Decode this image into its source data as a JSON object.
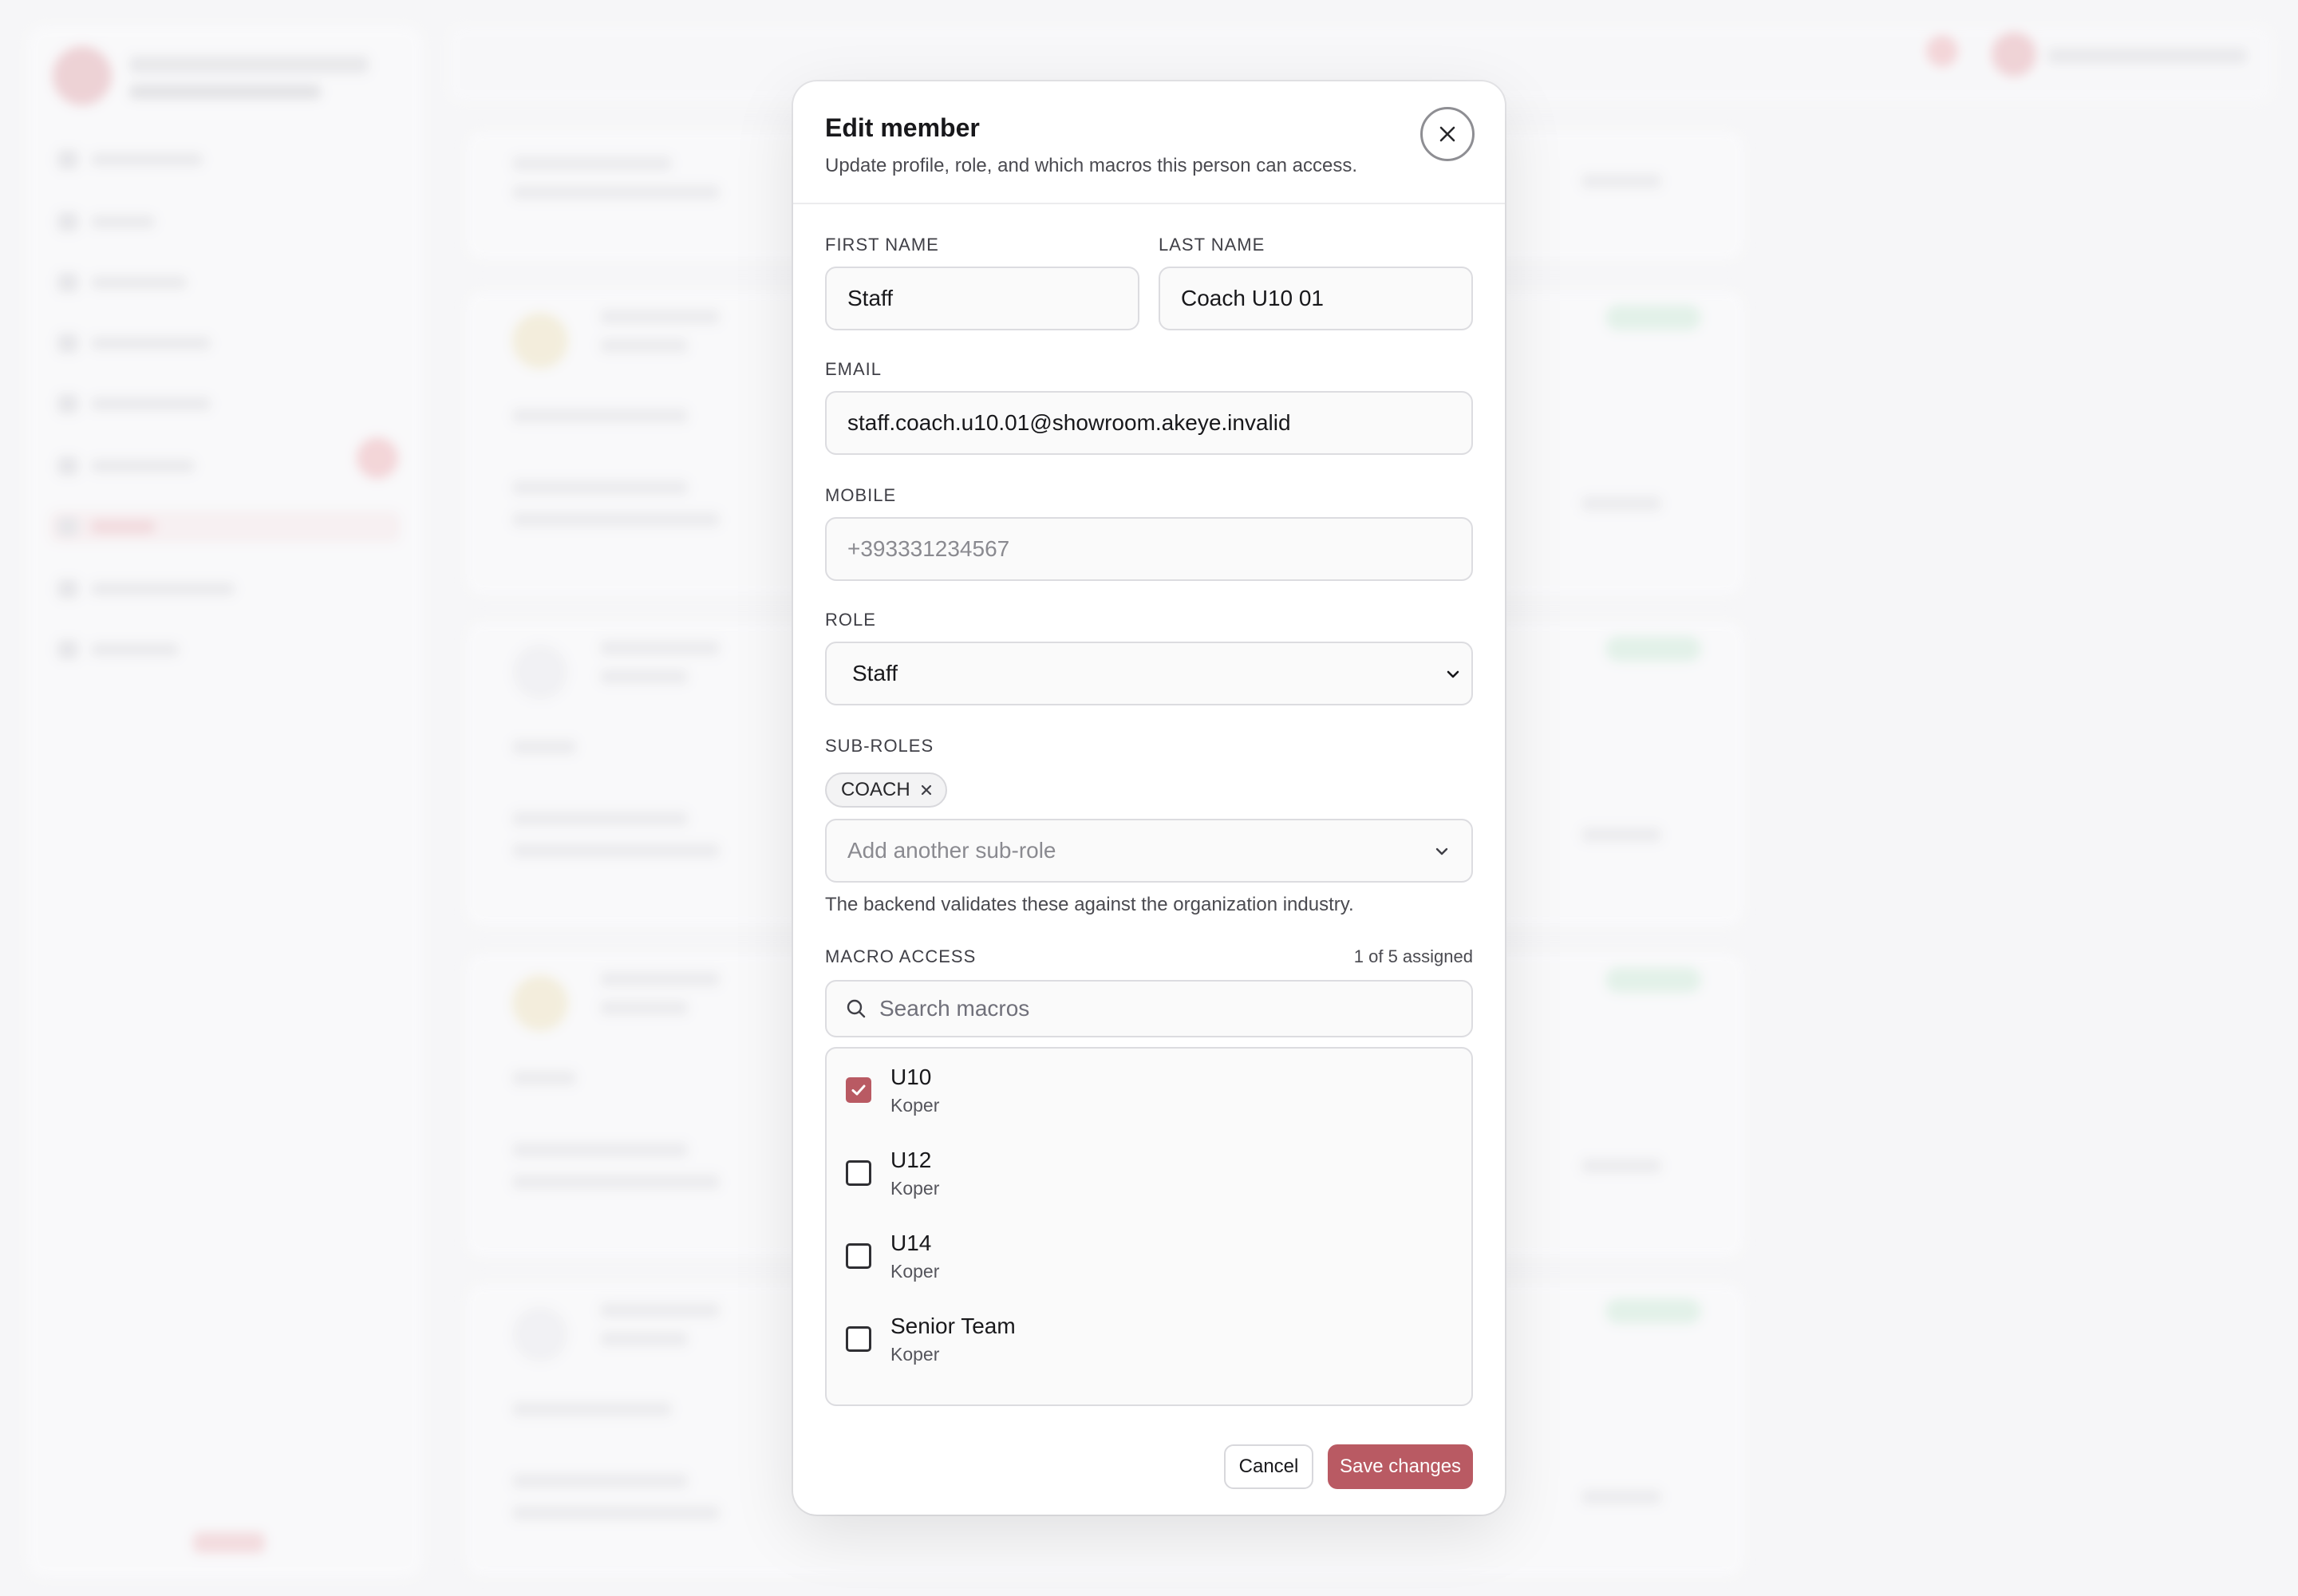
{
  "modal": {
    "title": "Edit member",
    "subtitle": "Update profile, role, and which macros this person can access."
  },
  "fields": {
    "first_name_label": "FIRST NAME",
    "first_name_value": "Staff",
    "last_name_label": "LAST NAME",
    "last_name_value": "Coach U10 01",
    "email_label": "EMAIL",
    "email_value": "staff.coach.u10.01@showroom.akeye.invalid",
    "mobile_label": "MOBILE",
    "mobile_placeholder": "+393331234567",
    "role_label": "ROLE",
    "role_value": "Staff"
  },
  "sub_roles": {
    "label": "SUB-ROLES",
    "chips": [
      "COACH"
    ],
    "add_placeholder": "Add another sub-role",
    "hint": "The backend validates these against the organization industry."
  },
  "macro_access": {
    "label": "MACRO ACCESS",
    "assigned_count": "1 of 5 assigned",
    "search_placeholder": "Search macros",
    "items": [
      {
        "name": "U10",
        "location": "Koper",
        "checked": true
      },
      {
        "name": "U12",
        "location": "Koper",
        "checked": false
      },
      {
        "name": "U14",
        "location": "Koper",
        "checked": false
      },
      {
        "name": "Senior Team",
        "location": "Koper",
        "checked": false
      }
    ]
  },
  "actions": {
    "cancel_label": "Cancel",
    "save_label": "Save changes"
  },
  "colors": {
    "accent": "#b95a63"
  }
}
